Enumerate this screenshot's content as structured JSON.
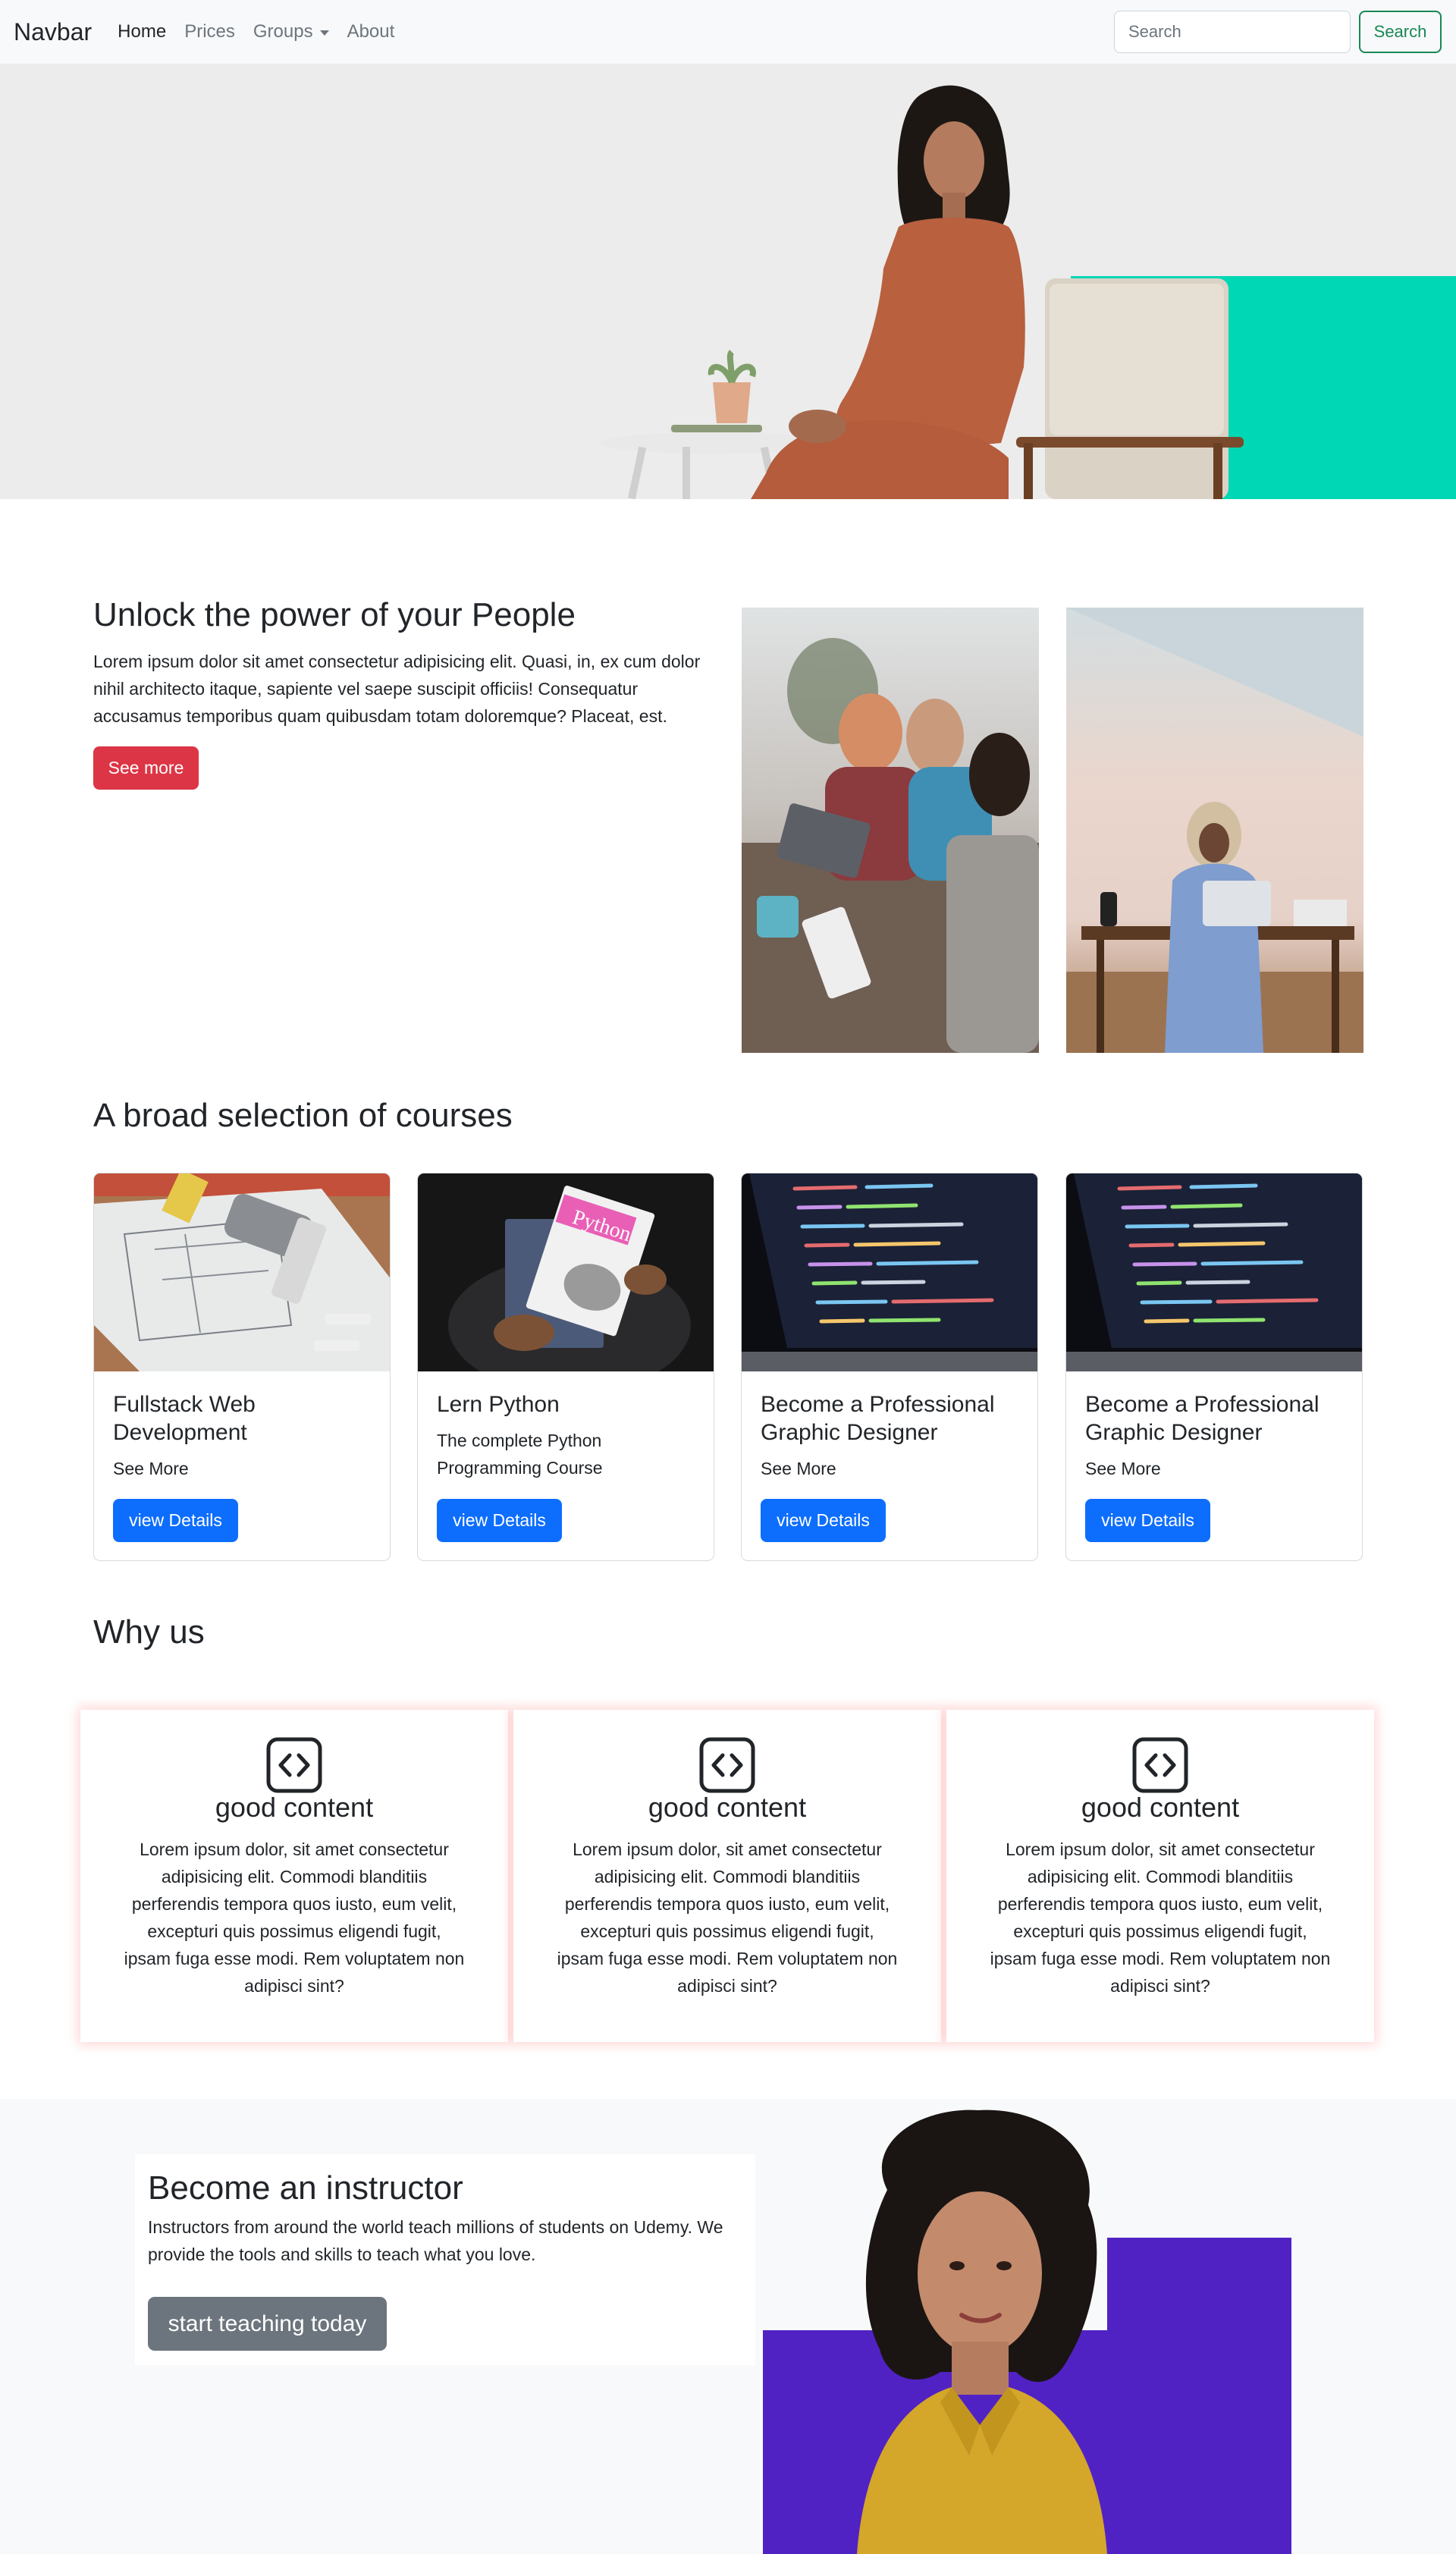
{
  "navbar": {
    "brand": "Navbar",
    "links": [
      {
        "label": "Home"
      },
      {
        "label": "Prices"
      },
      {
        "label": "Groups"
      },
      {
        "label": "About"
      }
    ],
    "search_placeholder": "Search",
    "search_button": "Search"
  },
  "hero": {
    "image": "woman-sitting-in-chair-photo",
    "accent_color": "#00d7b4"
  },
  "unlock": {
    "title": "Unlock the power of your People",
    "text": "Lorem ipsum dolor sit amet consectetur adipisicing elit. Quasi, in, ex cum dolor nihil architecto itaque, sapiente vel saepe suscipit officiis! Consequatur accusamus temporibus quam quibusdam totam doloremque? Placeat, est.",
    "button": "See more",
    "button_color": "#dc3545"
  },
  "courses": {
    "title": "A broad selection of courses",
    "cards": [
      {
        "title": "Fullstack Web Development",
        "text": "See More",
        "button": "view Details"
      },
      {
        "title": "Lern Python",
        "text": "The complete Python Programming Course",
        "button": "view Details"
      },
      {
        "title": "Become a Professional Graphic Designer",
        "text": "See More",
        "button": "view Details"
      },
      {
        "title": "Become a Professional Graphic Designer",
        "text": "See More",
        "button": "view Details"
      }
    ],
    "python_book_label": "Python"
  },
  "why": {
    "title": "Why us",
    "cards": [
      {
        "icon": "code-icon",
        "title": "good content",
        "text": "Lorem ipsum dolor, sit amet consectetur adipisicing elit. Commodi blanditiis perferendis tempora quos iusto, eum velit, excepturi quis possimus eligendi fugit, ipsam fuga esse modi. Rem voluptatem non adipisci sint?"
      },
      {
        "icon": "code-icon",
        "title": "good content",
        "text": "Lorem ipsum dolor, sit amet consectetur adipisicing elit. Commodi blanditiis perferendis tempora quos iusto, eum velit, excepturi quis possimus eligendi fugit, ipsam fuga esse modi. Rem voluptatem non adipisci sint?"
      },
      {
        "icon": "code-icon",
        "title": "good content",
        "text": "Lorem ipsum dolor, sit amet consectetur adipisicing elit. Commodi blanditiis perferendis tempora quos iusto, eum velit, excepturi quis possimus eligendi fugit, ipsam fuga esse modi. Rem voluptatem non adipisci sint?"
      }
    ]
  },
  "instructor": {
    "title": "Become an instructor",
    "text": "Instructors from around the world teach millions of students on Udemy. We provide the tools and skills to teach what you love.",
    "button": "start teaching today",
    "accent_color": "#5022c3"
  }
}
